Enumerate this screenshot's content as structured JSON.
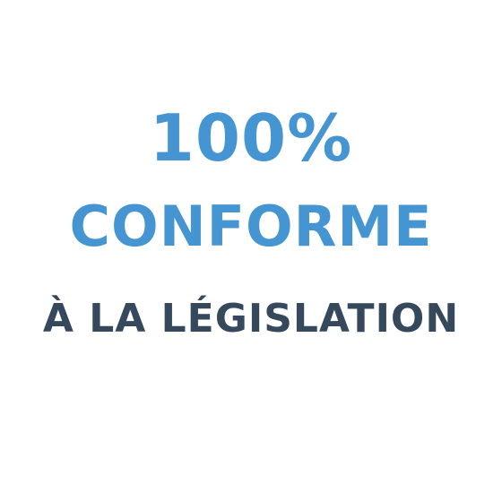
{
  "headline": {
    "line1": "100%",
    "line2": "CONFORME",
    "line3": "À LA LÉGISLATION"
  },
  "colors": {
    "accent": "#4595D2",
    "text_dark": "#36495C",
    "background": "#FFFFFF"
  }
}
